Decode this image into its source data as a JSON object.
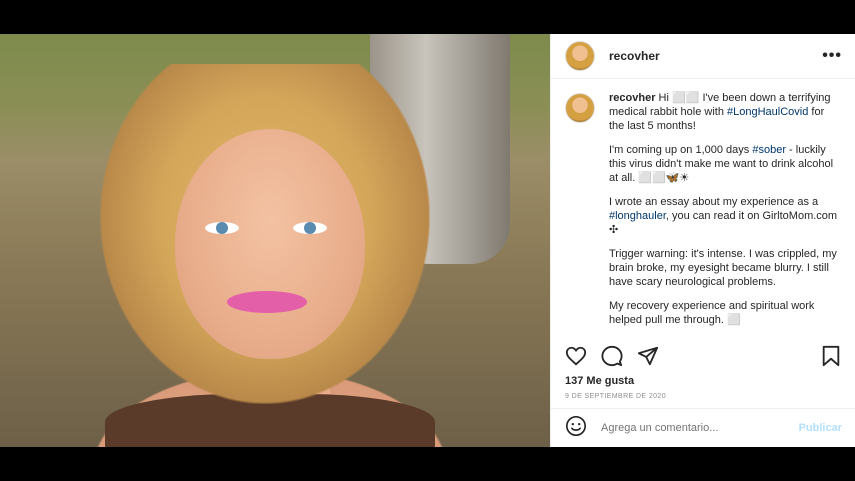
{
  "post": {
    "username": "recovher",
    "more_label": "•••",
    "caption_lines": {
      "p1_pre": "Hi ⬜⬜ I've been down a terrifying medical rabbit hole with ",
      "p1_tag": "#LongHaulCovid",
      "p1_post": " for the last 5 months!",
      "p2_pre": "I'm coming up on 1,000 days ",
      "p2_tag": "#sober",
      "p2_post": " - luckily this virus didn't make me want to drink alcohol at all. ⬜⬜🦋☀",
      "p3_pre": "I wrote an essay about my experience as a ",
      "p3_tag": "#longhauler",
      "p3_post": ", you can read it on GirltoMom.com ✣",
      "p4": "Trigger warning: it's intense. I was crippled, my brain broke, my eyesight became blurry. I still have scary neurological problems.",
      "p5": "My recovery experience and spiritual work helped pull me through. ⬜"
    },
    "likes": "137 Me gusta",
    "date": "9 DE SEPTIEMBRE DE 2020",
    "comment_placeholder": "Agrega un comentario...",
    "post_button": "Publicar",
    "icons": [
      "heart-icon",
      "comment-icon",
      "share-icon",
      "bookmark-icon",
      "emoji-icon"
    ]
  }
}
